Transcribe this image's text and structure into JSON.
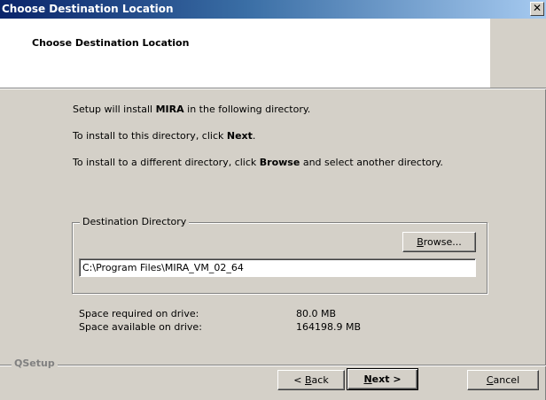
{
  "window": {
    "title": "Choose Destination Location",
    "close_glyph": "✕"
  },
  "header": {
    "title": "Choose Destination Location"
  },
  "body": {
    "line1_pre": "Setup will install ",
    "line1_bold": "MIRA",
    "line1_post": " in the following directory.",
    "line2_pre": "To install to this directory, click ",
    "line2_bold": "Next",
    "line2_post": ".",
    "line3_pre": "To install to a different directory, click ",
    "line3_bold": "Browse",
    "line3_post": " and select another directory."
  },
  "destination": {
    "group_label": "Destination Directory",
    "browse_pre": "",
    "browse_underline": "B",
    "browse_post": "rowse...",
    "path": "C:\\Program Files\\MIRA_VM_02_64"
  },
  "space": {
    "required_label": "Space required on drive:",
    "required_value": "80.0 MB",
    "available_label": "Space available on drive:",
    "available_value": "164198.9 MB"
  },
  "footer": {
    "brand": "QSetup",
    "back_pre": "< ",
    "back_underline": "B",
    "back_post": "ack",
    "next_underline": "N",
    "next_post": "ext >",
    "cancel_underline": "C",
    "cancel_post": "ancel"
  },
  "colors": {
    "dialog_bg": "#d4d0c8",
    "title_gradient_start": "#0a246a",
    "title_gradient_end": "#a6caf0"
  }
}
